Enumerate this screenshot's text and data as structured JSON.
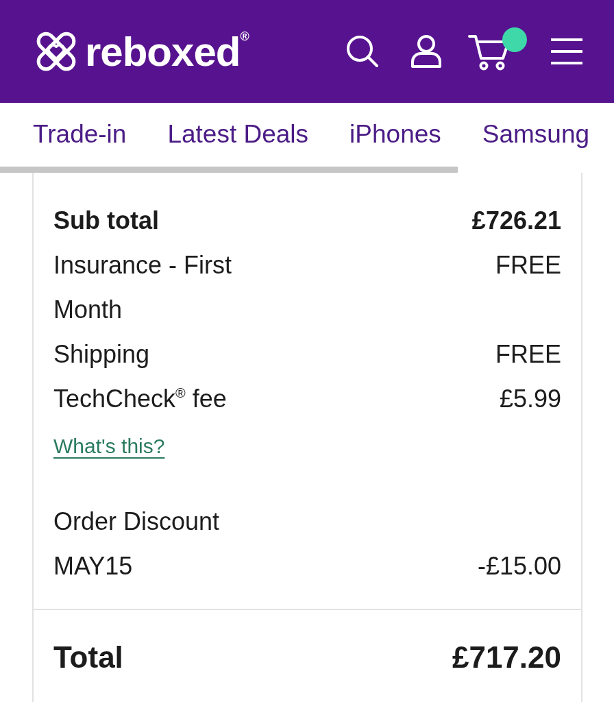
{
  "header": {
    "logo": "reboxed$^{®}$"
  },
  "nav": {
    "links": [
      "Trade-in",
      "Latest Deals",
      "iPhones",
      "Samsung"
    ]
  },
  "summary": {
    "rows": [
      {
        "kind": "subtotal",
        "label": "Sub total",
        "value": "£726.21"
      },
      {
        "kind": "line",
        "label": "Insurance - First Month",
        "value": "FREE"
      },
      {
        "kind": "line",
        "label": "Shipping",
        "value": "FREE"
      },
      {
        "kind": "line",
        "label": "TechCheck$^{®}$ fee",
        "value": "£5.99"
      }
    ],
    "info_link": "What's this?",
    "discount": {
      "title": "Order Discount",
      "code": "MAY15",
      "amount": "-£15.00"
    },
    "total": {
      "label": "Total",
      "value": "£717.20"
    }
  }
}
